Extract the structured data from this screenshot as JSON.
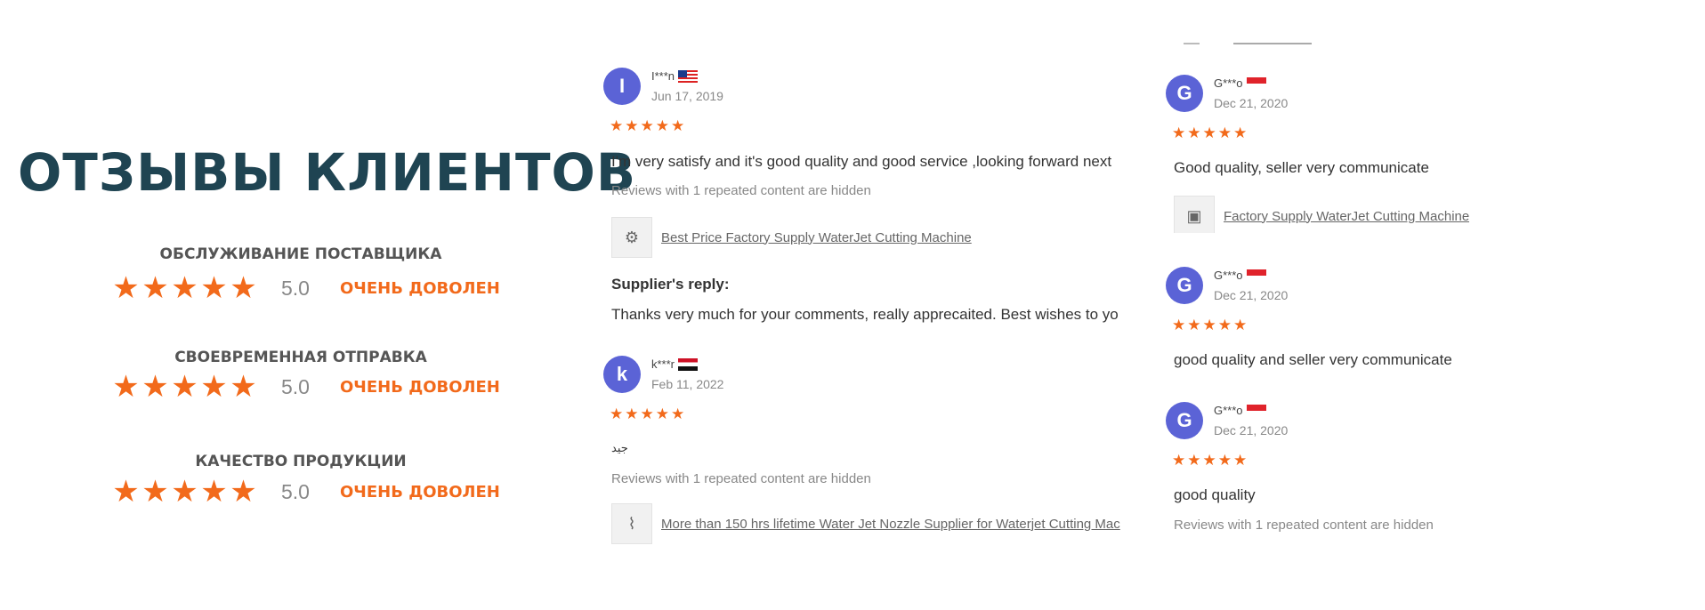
{
  "heading": "ОТЗЫВЫ КЛИЕНТОВ",
  "ratings": [
    {
      "label": "ОБСЛУЖИВАНИЕ ПОСТАВЩИКА",
      "score": "5.0",
      "verdict": "ОЧЕНЬ ДОВОЛЕН"
    },
    {
      "label": "СВОЕВРЕМЕННАЯ ОТПРАВКА",
      "score": "5.0",
      "verdict": "ОЧЕНЬ ДОВОЛЕН"
    },
    {
      "label": "КАЧЕСТВО ПРОДУКЦИИ",
      "score": "5.0",
      "verdict": "ОЧЕНЬ ДОВОЛЕН"
    }
  ],
  "reviews_left": [
    {
      "avatar": "I",
      "name": "I***n",
      "flag": "malaysia",
      "date": "Jun 17, 2019",
      "stars": "★★★★★",
      "text": "I'm very satisfy and it's good quality and good service ,looking forward next",
      "hidden_note": "Reviews with 1 repeated content are hidden",
      "product": "Best Price Factory Supply WaterJet Cutting Machine",
      "reply_title": "Supplier's reply:",
      "reply_text": "Thanks very much for your comments, really apprecaited. Best wishes to yo"
    },
    {
      "avatar": "k",
      "name": "k***r",
      "flag": "egypt",
      "date": "Feb 11, 2022",
      "stars": "★★★★★",
      "text": "جيد",
      "hidden_note": "Reviews with 1 repeated content are hidden",
      "product": "More than 150 hrs lifetime Water Jet Nozzle Supplier for Waterjet Cutting Mac"
    }
  ],
  "reviews_right": [
    {
      "avatar": "G",
      "name": "G***o",
      "flag": "indonesia",
      "date": "Dec 21, 2020",
      "stars": "★★★★★",
      "text": "Good quality, seller very communicate",
      "product": "Factory Supply WaterJet Cutting Machine"
    },
    {
      "avatar": "G",
      "name": "G***o",
      "flag": "indonesia",
      "date": "Dec 21, 2020",
      "stars": "★★★★★",
      "text": "good quality and seller very communicate"
    },
    {
      "avatar": "G",
      "name": "G***o",
      "flag": "indonesia",
      "date": "Dec 21, 2020",
      "stars": "★★★★★",
      "text": "good quality",
      "hidden_note": "Reviews with 1 repeated content are hidden"
    }
  ],
  "colors": {
    "accent": "#f26a1b",
    "heading": "#1f4452",
    "avatar": "#5b63d6"
  }
}
